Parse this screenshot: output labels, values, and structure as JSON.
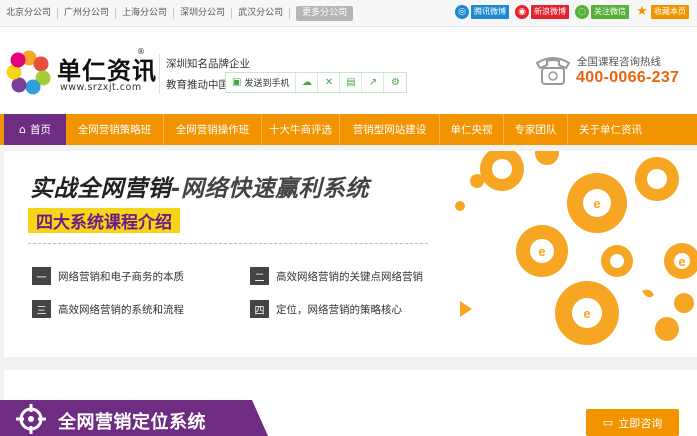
{
  "topbar": {
    "branches": [
      "北京分公司",
      "广州分公司",
      "上海分公司",
      "深圳分公司",
      "武汉分公司"
    ],
    "more_label": "更多分公司",
    "socials": [
      {
        "label": "腾讯微博",
        "color": "#1e88d2"
      },
      {
        "label": "新浪微博",
        "color": "#e5232d"
      },
      {
        "label": "关注微信",
        "color": "#55b13a"
      },
      {
        "label": "收藏本页",
        "color": "#f29400"
      }
    ]
  },
  "header": {
    "logo_text": "单仁资讯",
    "logo_reg": "®",
    "logo_url": "www.srzxjt.com",
    "slogan_line1": "深圳知名品牌企业",
    "slogan_line2": "教育推动中国",
    "share_label": "发送到手机",
    "hotline_label": "全国课程咨询热线",
    "hotline_number": "400-0066-237"
  },
  "nav": {
    "home_label": "首页",
    "items": [
      "全网营销策略班",
      "全网营销操作班",
      "十大牛商评选",
      "营销型网站建设",
      "单仁央视",
      "专家团队",
      "关于单仁资讯"
    ]
  },
  "banner": {
    "title_part1": "实战全网营销",
    "title_part2": "-网络快速赢利系统",
    "subtitle": "四大系统课程介绍",
    "features": [
      {
        "num": "一",
        "text": "网络营销和电子商务的本质"
      },
      {
        "num": "二",
        "text": "高效网络营销的关键点网络营销"
      },
      {
        "num": "三",
        "text": "高效网络营销的系统和流程"
      },
      {
        "num": "四",
        "text": "定位，网络营销的策略核心"
      }
    ]
  },
  "section": {
    "title": "全网营销定位系统",
    "consult_label": "立即咨询"
  },
  "colors": {
    "orange": "#f29400",
    "purple": "#6e2c83",
    "yellow": "#f7d417"
  }
}
